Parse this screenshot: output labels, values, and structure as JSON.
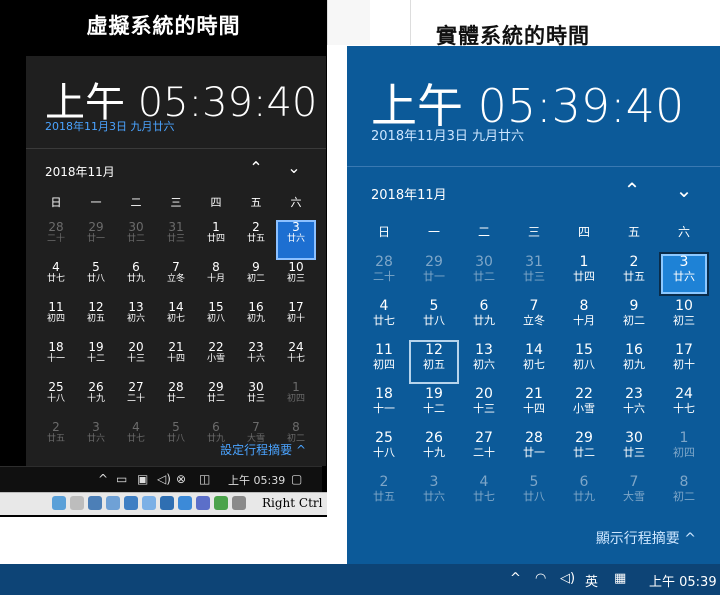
{
  "captions": {
    "virtual": "虛擬系統的時間",
    "real": "實體系統的時間"
  },
  "clock": {
    "time": "上午 05:39:40",
    "date": "2018年11月3日 九月廿六",
    "month": "2018年11月"
  },
  "weekdays": [
    "日",
    "一",
    "二",
    "三",
    "四",
    "五",
    "六"
  ],
  "weeks": [
    [
      {
        "n": "28",
        "l": "二十",
        "d": true
      },
      {
        "n": "29",
        "l": "廿一",
        "d": true
      },
      {
        "n": "30",
        "l": "廿二",
        "d": true
      },
      {
        "n": "31",
        "l": "廿三",
        "d": true
      },
      {
        "n": "1",
        "l": "廿四"
      },
      {
        "n": "2",
        "l": "廿五"
      },
      {
        "n": "3",
        "l": "廿六",
        "t": true
      }
    ],
    [
      {
        "n": "4",
        "l": "廿七"
      },
      {
        "n": "5",
        "l": "廿八"
      },
      {
        "n": "6",
        "l": "廿九"
      },
      {
        "n": "7",
        "l": "立冬"
      },
      {
        "n": "8",
        "l": "十月"
      },
      {
        "n": "9",
        "l": "初二"
      },
      {
        "n": "10",
        "l": "初三"
      }
    ],
    [
      {
        "n": "11",
        "l": "初四"
      },
      {
        "n": "12",
        "l": "初五",
        "s": true
      },
      {
        "n": "13",
        "l": "初六"
      },
      {
        "n": "14",
        "l": "初七"
      },
      {
        "n": "15",
        "l": "初八"
      },
      {
        "n": "16",
        "l": "初九"
      },
      {
        "n": "17",
        "l": "初十"
      }
    ],
    [
      {
        "n": "18",
        "l": "十一"
      },
      {
        "n": "19",
        "l": "十二"
      },
      {
        "n": "20",
        "l": "十三"
      },
      {
        "n": "21",
        "l": "十四"
      },
      {
        "n": "22",
        "l": "小雪"
      },
      {
        "n": "23",
        "l": "十六"
      },
      {
        "n": "24",
        "l": "十七"
      }
    ],
    [
      {
        "n": "25",
        "l": "十八"
      },
      {
        "n": "26",
        "l": "十九"
      },
      {
        "n": "27",
        "l": "二十"
      },
      {
        "n": "28",
        "l": "廿一"
      },
      {
        "n": "29",
        "l": "廿二"
      },
      {
        "n": "30",
        "l": "廿三"
      },
      {
        "n": "1",
        "l": "初四",
        "d": true
      }
    ],
    [
      {
        "n": "2",
        "l": "廿五",
        "d": true
      },
      {
        "n": "3",
        "l": "廿六",
        "d": true
      },
      {
        "n": "4",
        "l": "廿七",
        "d": true
      },
      {
        "n": "5",
        "l": "廿八",
        "d": true
      },
      {
        "n": "6",
        "l": "廿九",
        "d": true
      },
      {
        "n": "7",
        "l": "大雪",
        "d": true
      },
      {
        "n": "8",
        "l": "初二",
        "d": true
      }
    ]
  ],
  "virtual": {
    "agenda": "設定行程摘要 ^",
    "taskbar_time": "上午 05:39",
    "status_right": "Right Ctrl"
  },
  "real": {
    "agenda": "顯示行程摘要 ^",
    "taskbar_time": "上午 05:39",
    "ime": "英"
  },
  "icons": {
    "up": "⌃",
    "down": "⌄",
    "chevron_up_tray": "^",
    "speaker": "🔊",
    "network": "wifi",
    "notify": "□"
  },
  "colors": {
    "vm_bg": "#1f1f1f",
    "real_bg": "#0c5a99",
    "accent": "#1e82d6"
  }
}
